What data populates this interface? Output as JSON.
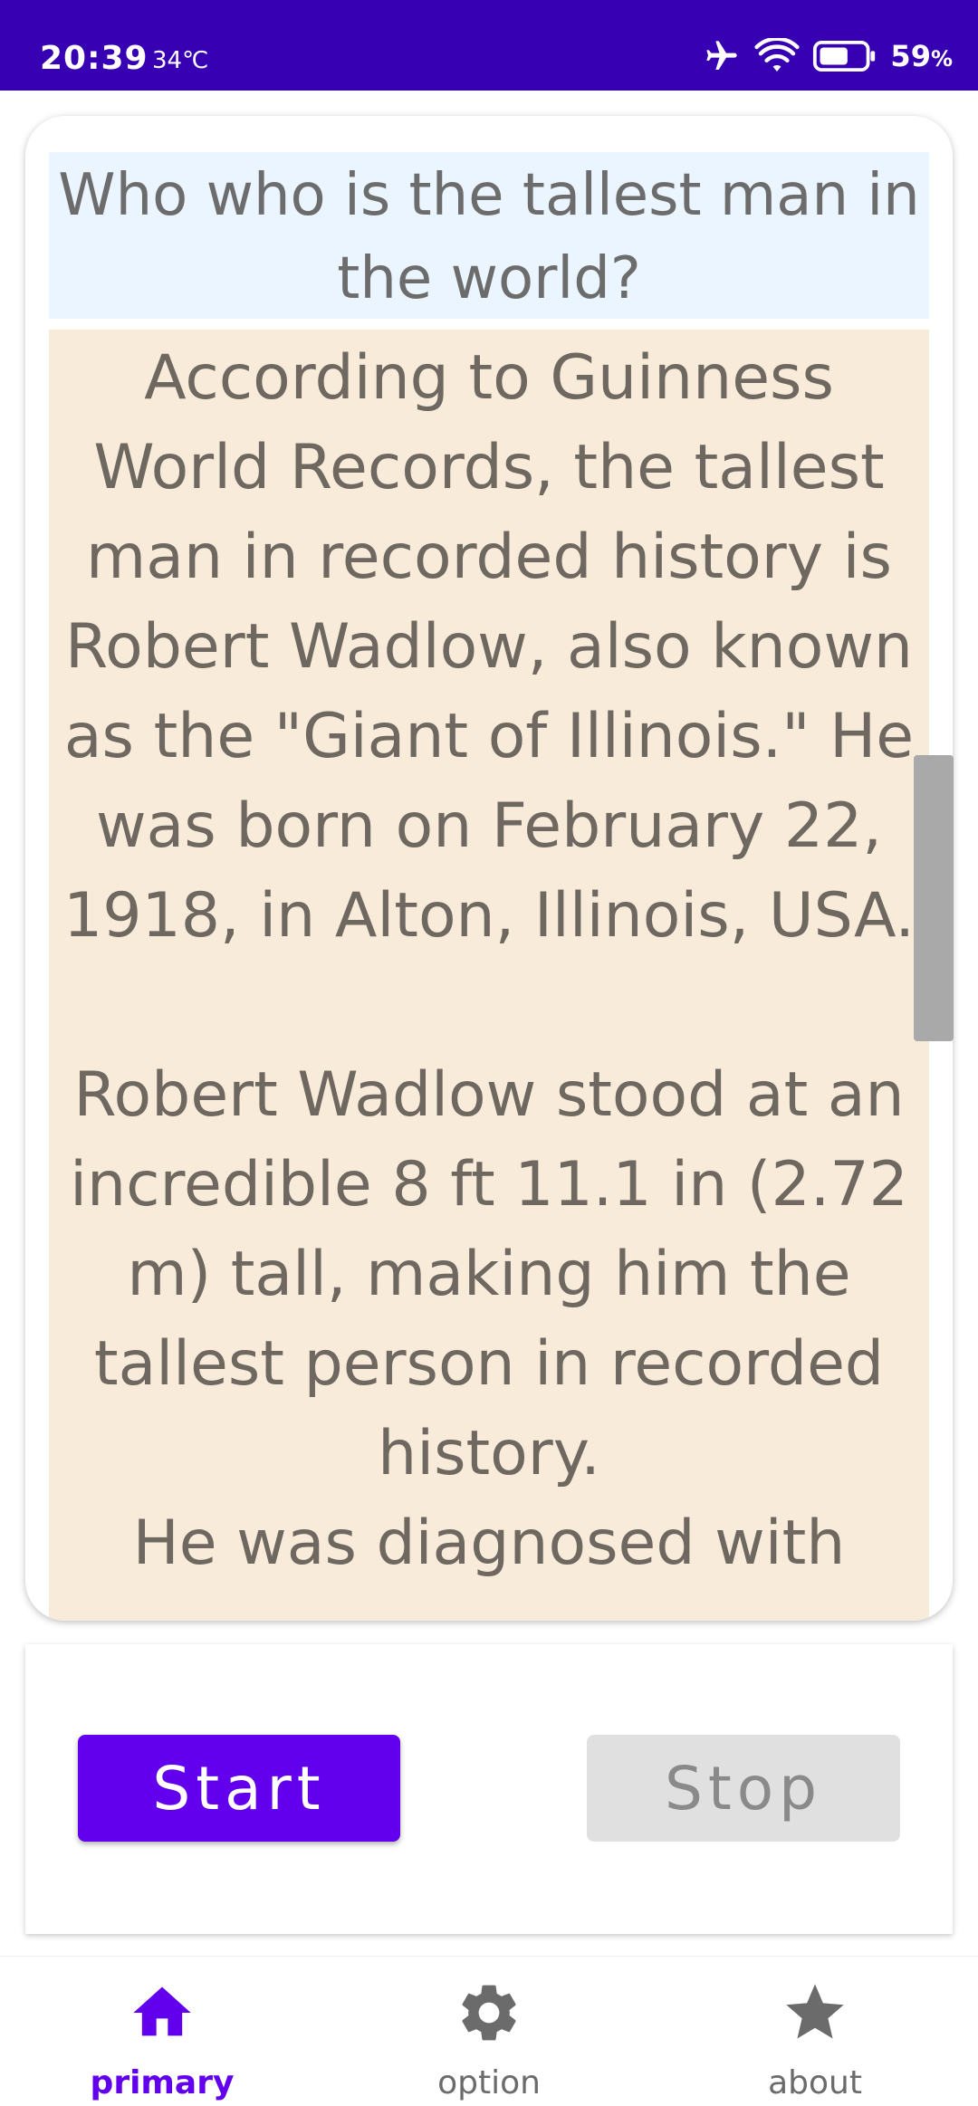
{
  "status_bar": {
    "time": "20:39",
    "temperature": "34℃",
    "battery_percent": "59",
    "battery_unit": "%",
    "icons": [
      "airplane-icon",
      "wifi-icon",
      "battery-icon"
    ]
  },
  "chat": {
    "question": "Who who is the tallest man in the world?",
    "answer": "According to Guinness World Records, the tallest man in recorded history is Robert Wadlow, also known as the \"Giant of Illinois.\" He was born on February 22, 1918, in Alton, Illinois, USA.\n\nRobert Wadlow stood at an incredible 8 ft 11.1 in (2.72 m) tall, making him the tallest person in recorded history.\nHe was diagnosed with"
  },
  "controls": {
    "start_label": "Start",
    "stop_label": "Stop"
  },
  "bottom_nav": {
    "items": [
      {
        "label": "primary",
        "icon": "home-icon",
        "active": true
      },
      {
        "label": "option",
        "icon": "gear-icon",
        "active": false
      },
      {
        "label": "about",
        "icon": "star-icon",
        "active": false
      }
    ]
  },
  "colors": {
    "status_bar": "#3700b3",
    "accent": "#6200ee",
    "question_bg": "#eaf5ff",
    "answer_bg": "#f9ebda",
    "stop_bg": "#e0e0e0"
  }
}
